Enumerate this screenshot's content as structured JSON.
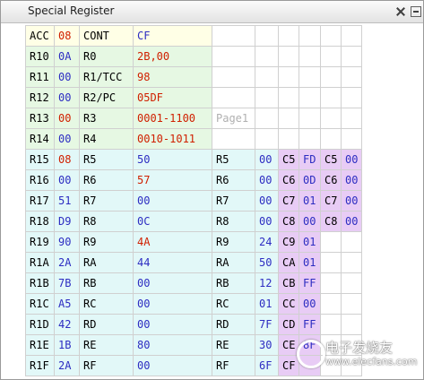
{
  "window": {
    "title": "Special Register"
  },
  "rows": [
    [
      "ACC",
      "08",
      "CONT",
      "CF",
      "",
      "",
      "",
      "",
      "",
      ""
    ],
    [
      "R10",
      "0A",
      "R0",
      "2B,00",
      "",
      "",
      "",
      "",
      "",
      ""
    ],
    [
      "R11",
      "00",
      "R1/TCC",
      "98",
      "",
      "",
      "",
      "",
      "",
      ""
    ],
    [
      "R12",
      "00",
      "R2/PC",
      "05DF",
      "",
      "",
      "",
      "",
      "",
      ""
    ],
    [
      "R13",
      "00",
      "R3",
      "0001-1100",
      "Page1",
      "",
      "",
      "",
      "",
      ""
    ],
    [
      "R14",
      "00",
      "R4",
      "0010-1011",
      "",
      "",
      "",
      "",
      "",
      ""
    ],
    [
      "R15",
      "08",
      "R5",
      "50",
      "R5",
      "00",
      "C5",
      "FD",
      "C5",
      "00"
    ],
    [
      "R16",
      "00",
      "R6",
      "57",
      "R6",
      "00",
      "C6",
      "0D",
      "C6",
      "00"
    ],
    [
      "R17",
      "51",
      "R7",
      "00",
      "R7",
      "00",
      "C7",
      "01",
      "C7",
      "00"
    ],
    [
      "R18",
      "D9",
      "R8",
      "0C",
      "R8",
      "00",
      "C8",
      "00",
      "C8",
      "00"
    ],
    [
      "R19",
      "90",
      "R9",
      "4A",
      "R9",
      "24",
      "C9",
      "01",
      "",
      ""
    ],
    [
      "R1A",
      "2A",
      "RA",
      "44",
      "RA",
      "50",
      "CA",
      "01",
      "",
      ""
    ],
    [
      "R1B",
      "7B",
      "RB",
      "00",
      "RB",
      "12",
      "CB",
      "FF",
      "",
      ""
    ],
    [
      "R1C",
      "A5",
      "RC",
      "00",
      "RC",
      "01",
      "CC",
      "00",
      "",
      ""
    ],
    [
      "R1D",
      "42",
      "RD",
      "00",
      "RD",
      "7F",
      "CD",
      "FF",
      "",
      ""
    ],
    [
      "R1E",
      "1B",
      "RE",
      "80",
      "RE",
      "30",
      "CE",
      "8F",
      "",
      ""
    ],
    [
      "R1F",
      "2A",
      "RF",
      "00",
      "RF",
      "6F",
      "CF",
      "",
      "",
      ""
    ]
  ],
  "watermark": {
    "text": "电子发烧友",
    "sub": "www.elecfans.com"
  },
  "colors": {
    "red_value": "#d02000",
    "blue_value": "#2d2dc2",
    "yellow_bg": "#ffffe6",
    "green_bg": "#e6f8e3",
    "cyan_bg": "#e2f8f8",
    "purple_bg": "#e8ccf5"
  }
}
